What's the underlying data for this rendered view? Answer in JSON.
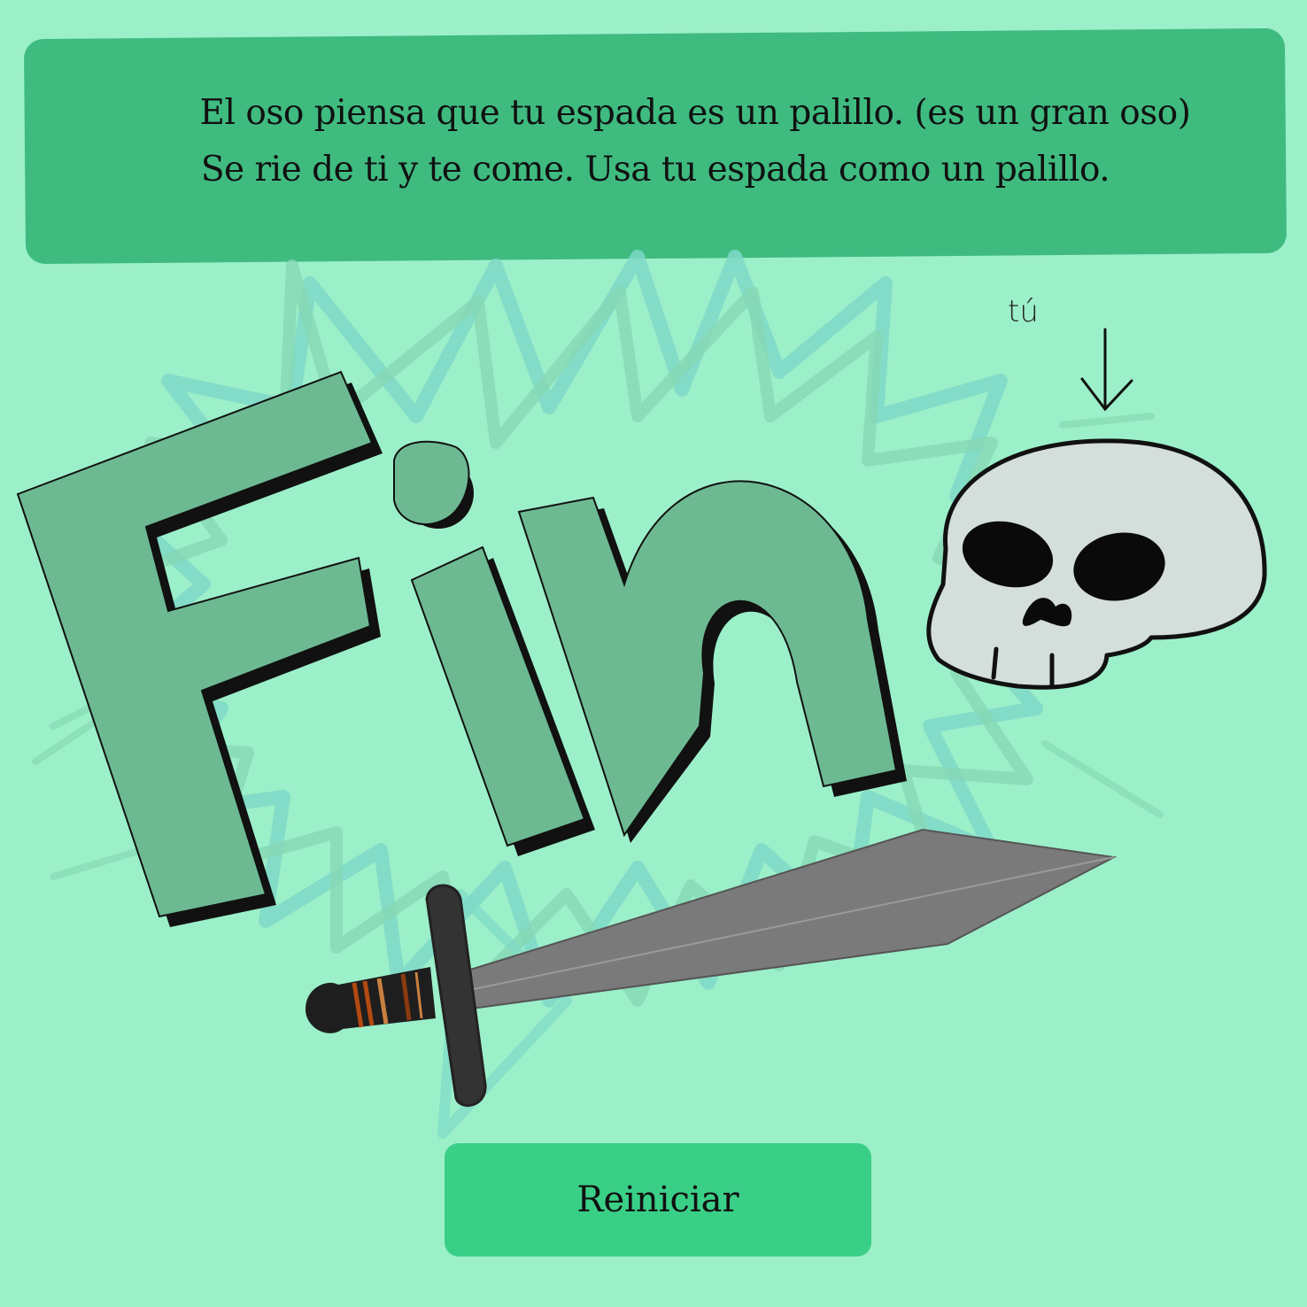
{
  "story": {
    "line1": "El oso piensa que tu espada es un palillo. (es un gran oso)",
    "line2": "Se rie de ti y te come. Usa tu espada como un palillo."
  },
  "title": "Fin",
  "annotation": "tú",
  "restart_label": "Reiniciar",
  "colors": {
    "background": "#9cf0c9",
    "panel": "#3fbb80",
    "button": "#3acf87",
    "letters": "#6dba92",
    "skull": "#d4deda",
    "blade": "#7a7a7a"
  }
}
